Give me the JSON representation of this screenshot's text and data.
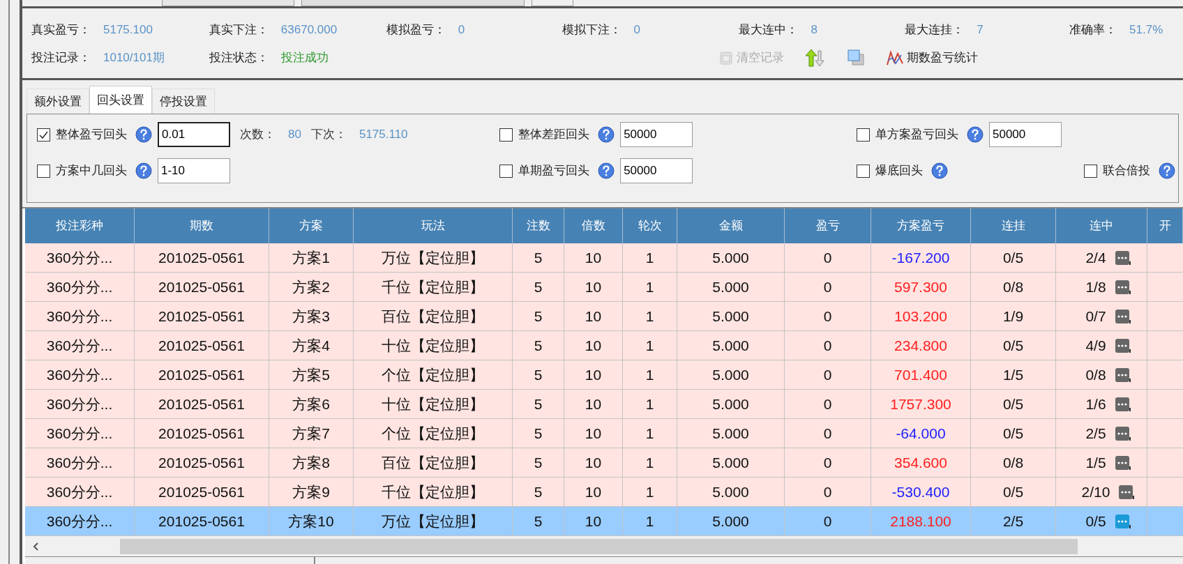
{
  "stats": {
    "rows": [
      [
        {
          "label": "真实盈亏：",
          "value": "5175.100"
        },
        {
          "label": "真实下注：",
          "value": "63670.000"
        },
        {
          "label": "模拟盈亏：",
          "value": "0"
        },
        {
          "label": "模拟下注：",
          "value": "0"
        },
        {
          "label": "最大连中：",
          "value": "8"
        },
        {
          "label": "最大连挂：",
          "value": "7"
        },
        {
          "label": "准确率：",
          "value": "51.7%"
        }
      ],
      [
        {
          "label": "投注记录：",
          "value": "1010/101期"
        },
        {
          "label": "投注状态：",
          "value": "投注成功",
          "kind": "status"
        }
      ]
    ]
  },
  "toolbar": [
    {
      "kind": "clear",
      "label": "清空记录",
      "disabled": true
    },
    {
      "kind": "sort",
      "disabled": false
    },
    {
      "kind": "window",
      "disabled": false
    },
    {
      "kind": "chart",
      "label": "期数盈亏统计",
      "disabled": false
    }
  ],
  "tabs": [
    {
      "label": "额外设置",
      "selected": false
    },
    {
      "label": "回头设置",
      "selected": true
    },
    {
      "label": "停投设置",
      "selected": false
    }
  ],
  "settings": {
    "columns": [
      {
        "rows": [
          [
            {
              "kind": "option",
              "label": "整体盈亏回头",
              "checked": true,
              "value": "0.01"
            },
            {
              "kind": "stat",
              "label": "次数：",
              "value": "80"
            },
            {
              "kind": "stat",
              "label": "下次：",
              "value": "5175.110"
            }
          ],
          [
            {
              "kind": "option",
              "label": "方案中几回头",
              "checked": false,
              "value": "1-10"
            }
          ]
        ]
      },
      {
        "rows": [
          [
            {
              "kind": "option",
              "label": "整体差距回头",
              "checked": false,
              "value": "50000"
            }
          ],
          [
            {
              "kind": "option",
              "label": "单期盈亏回头",
              "checked": false,
              "value": "50000"
            }
          ]
        ]
      },
      {
        "rows": [
          [
            {
              "kind": "option",
              "label": "单方案盈亏回头",
              "checked": false,
              "value": "50000"
            }
          ],
          [
            {
              "kind": "option",
              "label": "爆底回头",
              "checked": false
            },
            {
              "kind": "option",
              "label": "联合倍投",
              "checked": false
            }
          ]
        ]
      }
    ]
  },
  "table": {
    "columns": [
      "投注彩种",
      "期数",
      "方案",
      "玩法",
      "注数",
      "倍数",
      "轮次",
      "金额",
      "盈亏",
      "方案盈亏",
      "连挂",
      "连中",
      "开"
    ],
    "rows": [
      {
        "cells": [
          "360分分...",
          "201025-0561",
          "方案1",
          "万位【定位胆】",
          "5",
          "10",
          "1",
          "5.000",
          "0",
          "-167.200",
          "0/5",
          "2/4"
        ],
        "color": "#2020ff",
        "selected": false
      },
      {
        "cells": [
          "360分分...",
          "201025-0561",
          "方案2",
          "千位【定位胆】",
          "5",
          "10",
          "1",
          "5.000",
          "0",
          "597.300",
          "0/8",
          "1/8"
        ],
        "color": "#ff2020",
        "selected": false
      },
      {
        "cells": [
          "360分分...",
          "201025-0561",
          "方案3",
          "百位【定位胆】",
          "5",
          "10",
          "1",
          "5.000",
          "0",
          "103.200",
          "1/9",
          "0/7"
        ],
        "color": "#ff2020",
        "selected": false
      },
      {
        "cells": [
          "360分分...",
          "201025-0561",
          "方案4",
          "十位【定位胆】",
          "5",
          "10",
          "1",
          "5.000",
          "0",
          "234.800",
          "0/5",
          "4/9"
        ],
        "color": "#ff2020",
        "selected": false
      },
      {
        "cells": [
          "360分分...",
          "201025-0561",
          "方案5",
          "个位【定位胆】",
          "5",
          "10",
          "1",
          "5.000",
          "0",
          "701.400",
          "1/5",
          "0/8"
        ],
        "color": "#ff2020",
        "selected": false
      },
      {
        "cells": [
          "360分分...",
          "201025-0561",
          "方案6",
          "十位【定位胆】",
          "5",
          "10",
          "1",
          "5.000",
          "0",
          "1757.300",
          "0/5",
          "1/6"
        ],
        "color": "#ff2020",
        "selected": false
      },
      {
        "cells": [
          "360分分...",
          "201025-0561",
          "方案7",
          "个位【定位胆】",
          "5",
          "10",
          "1",
          "5.000",
          "0",
          "-64.000",
          "0/5",
          "2/5"
        ],
        "color": "#2020ff",
        "selected": false
      },
      {
        "cells": [
          "360分分...",
          "201025-0561",
          "方案8",
          "百位【定位胆】",
          "5",
          "10",
          "1",
          "5.000",
          "0",
          "354.600",
          "0/8",
          "1/5"
        ],
        "color": "#ff2020",
        "selected": false
      },
      {
        "cells": [
          "360分分...",
          "201025-0561",
          "方案9",
          "千位【定位胆】",
          "5",
          "10",
          "1",
          "5.000",
          "0",
          "-530.400",
          "0/5",
          "2/10"
        ],
        "color": "#2020ff",
        "selected": false
      },
      {
        "cells": [
          "360分分...",
          "201025-0561",
          "方案10",
          "万位【定位胆】",
          "5",
          "10",
          "1",
          "5.000",
          "0",
          "2188.100",
          "2/5",
          "0/5"
        ],
        "color": "#ff2020",
        "selected": true
      }
    ]
  }
}
